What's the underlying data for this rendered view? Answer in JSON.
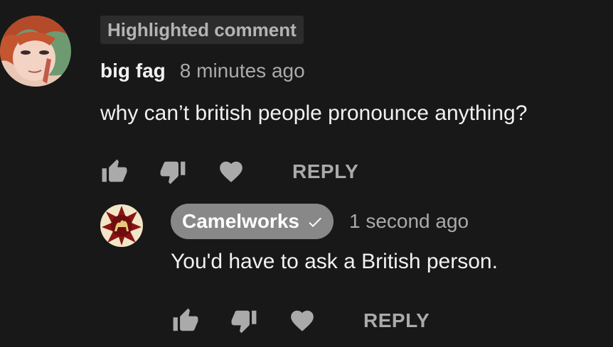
{
  "comment": {
    "badge": "Highlighted comment",
    "author": "big fag",
    "timestamp": "8 minutes ago",
    "text": "why can’t british people pronounce anything?",
    "actions": {
      "like_icon": "thumbs-up-icon",
      "dislike_icon": "thumbs-down-icon",
      "heart_icon": "heart-icon",
      "reply_label": "REPLY"
    }
  },
  "reply": {
    "author": "Camelworks",
    "verified_icon": "checkmark-icon",
    "timestamp": "1 second ago",
    "text": "You'd have to ask a British person.",
    "actions": {
      "like_icon": "thumbs-up-icon",
      "dislike_icon": "thumbs-down-icon",
      "heart_icon": "heart-icon",
      "reply_label": "REPLY"
    }
  },
  "colors": {
    "background": "#181818",
    "text_primary": "#f1f1f1",
    "text_secondary": "#aaaaaa",
    "badge_bg": "#2c2c2c",
    "author_pill_bg": "#888888"
  }
}
